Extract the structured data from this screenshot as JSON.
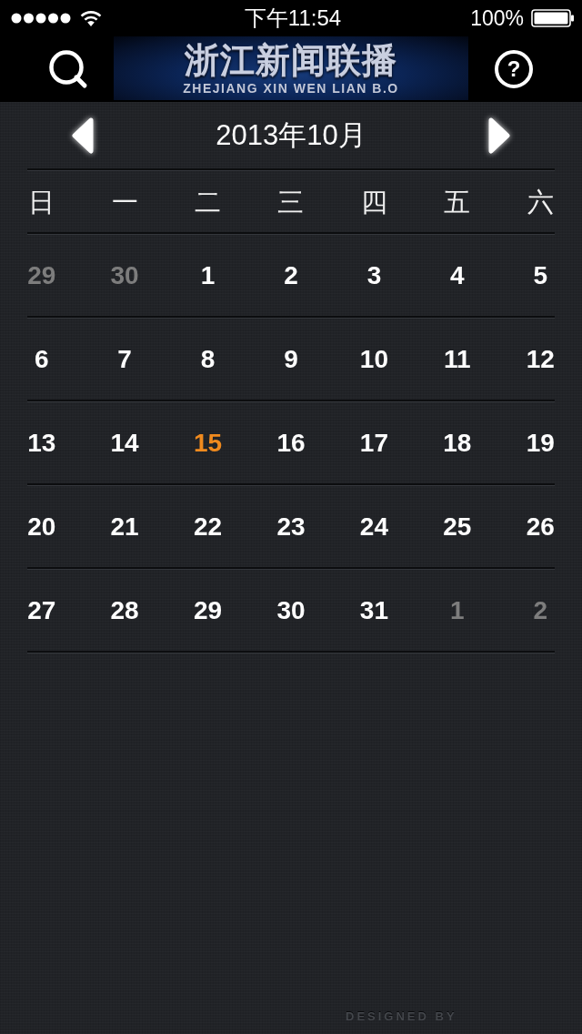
{
  "status_bar": {
    "time": "下午11:54",
    "battery": "100%"
  },
  "header": {
    "logo_title": "浙江新闻联播",
    "logo_subtitle": "ZHEJIANG XIN WEN LIAN B.O",
    "help": "?"
  },
  "month_nav": {
    "title": "2013年10月"
  },
  "weekdays": [
    "日",
    "一",
    "二",
    "三",
    "四",
    "五",
    "六"
  ],
  "weeks": [
    [
      {
        "day": "29",
        "outside_month": true,
        "today": false
      },
      {
        "day": "30",
        "outside_month": true,
        "today": false
      },
      {
        "day": "1",
        "outside_month": false,
        "today": false
      },
      {
        "day": "2",
        "outside_month": false,
        "today": false
      },
      {
        "day": "3",
        "outside_month": false,
        "today": false
      },
      {
        "day": "4",
        "outside_month": false,
        "today": false
      },
      {
        "day": "5",
        "outside_month": false,
        "today": false
      }
    ],
    [
      {
        "day": "6",
        "outside_month": false,
        "today": false
      },
      {
        "day": "7",
        "outside_month": false,
        "today": false
      },
      {
        "day": "8",
        "outside_month": false,
        "today": false
      },
      {
        "day": "9",
        "outside_month": false,
        "today": false
      },
      {
        "day": "10",
        "outside_month": false,
        "today": false
      },
      {
        "day": "11",
        "outside_month": false,
        "today": false
      },
      {
        "day": "12",
        "outside_month": false,
        "today": false
      }
    ],
    [
      {
        "day": "13",
        "outside_month": false,
        "today": false
      },
      {
        "day": "14",
        "outside_month": false,
        "today": false
      },
      {
        "day": "15",
        "outside_month": false,
        "today": true
      },
      {
        "day": "16",
        "outside_month": false,
        "today": false
      },
      {
        "day": "17",
        "outside_month": false,
        "today": false
      },
      {
        "day": "18",
        "outside_month": false,
        "today": false
      },
      {
        "day": "19",
        "outside_month": false,
        "today": false
      }
    ],
    [
      {
        "day": "20",
        "outside_month": false,
        "today": false
      },
      {
        "day": "21",
        "outside_month": false,
        "today": false
      },
      {
        "day": "22",
        "outside_month": false,
        "today": false
      },
      {
        "day": "23",
        "outside_month": false,
        "today": false
      },
      {
        "day": "24",
        "outside_month": false,
        "today": false
      },
      {
        "day": "25",
        "outside_month": false,
        "today": false
      },
      {
        "day": "26",
        "outside_month": false,
        "today": false
      }
    ],
    [
      {
        "day": "27",
        "outside_month": false,
        "today": false
      },
      {
        "day": "28",
        "outside_month": false,
        "today": false
      },
      {
        "day": "29",
        "outside_month": false,
        "today": false
      },
      {
        "day": "30",
        "outside_month": false,
        "today": false
      },
      {
        "day": "31",
        "outside_month": false,
        "today": false
      },
      {
        "day": "1",
        "outside_month": true,
        "today": false
      },
      {
        "day": "2",
        "outside_month": true,
        "today": false
      }
    ]
  ],
  "footer": {
    "credit": "DESIGNED BY"
  }
}
